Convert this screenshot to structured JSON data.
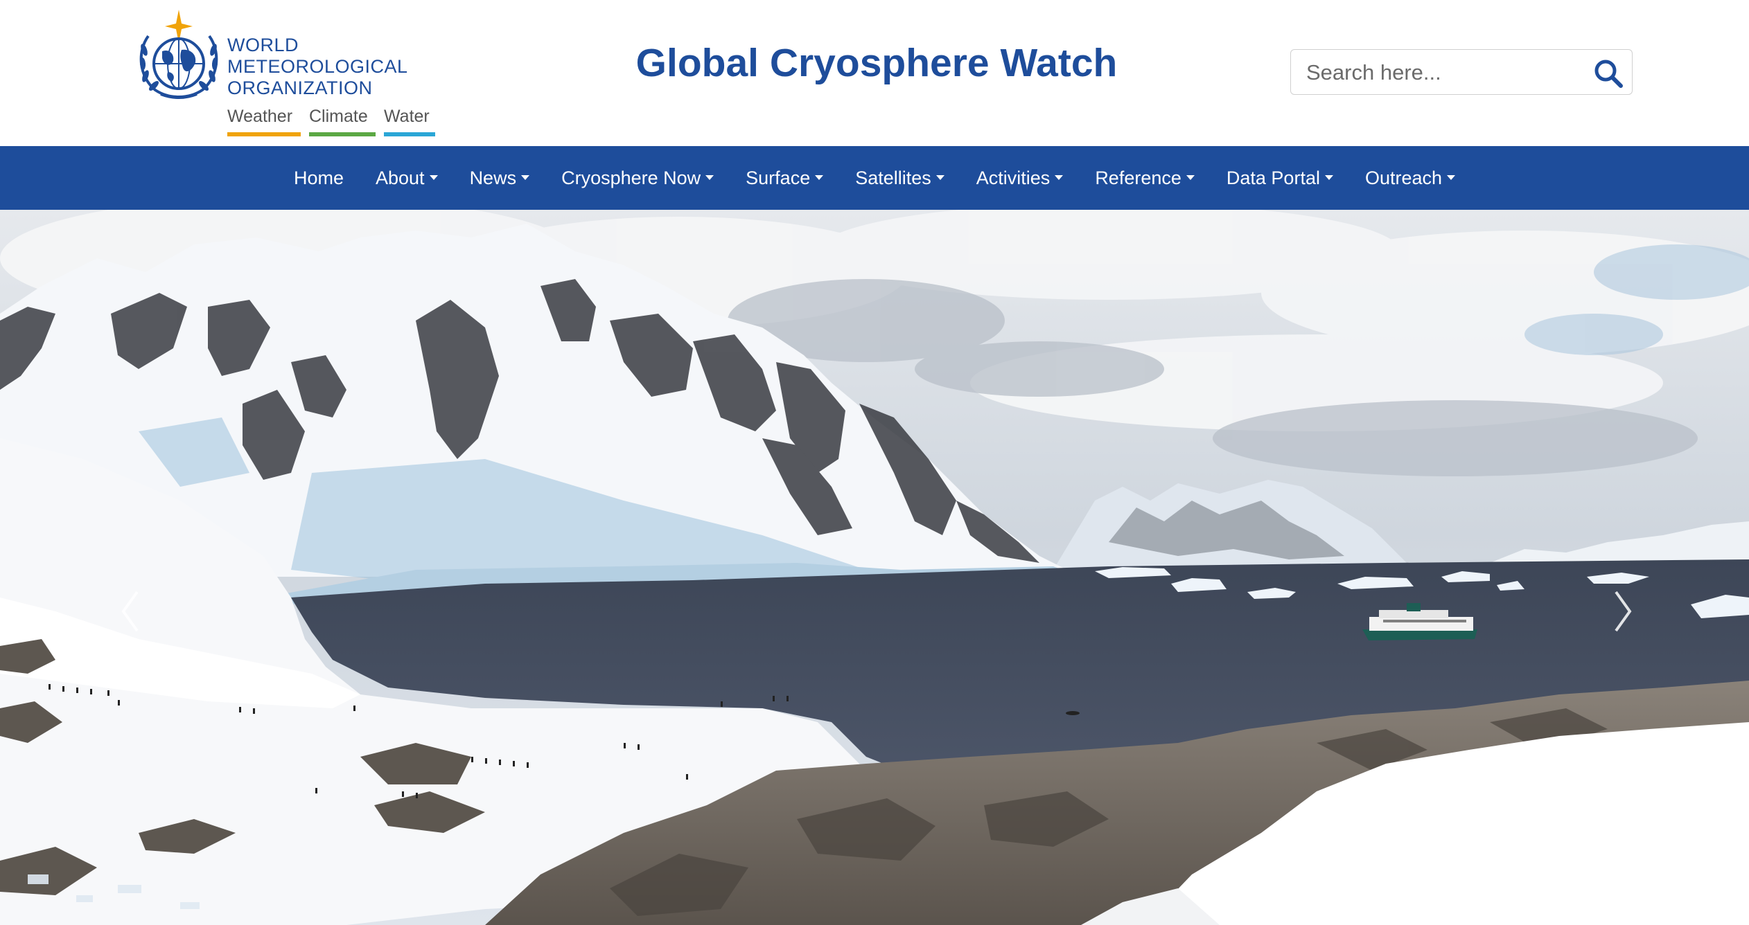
{
  "logo": {
    "org_lines": [
      "WORLD",
      "METEOROLOGICAL",
      "ORGANIZATION"
    ],
    "tags": [
      {
        "label": "Weather",
        "color": "#f0a30a"
      },
      {
        "label": "Climate",
        "color": "#5ba843"
      },
      {
        "label": "Water",
        "color": "#2aa6d6"
      }
    ]
  },
  "header": {
    "title": "Global Cryosphere Watch"
  },
  "search": {
    "placeholder": "Search here...",
    "value": ""
  },
  "nav": {
    "items": [
      {
        "label": "Home",
        "has_dropdown": false
      },
      {
        "label": "About",
        "has_dropdown": true
      },
      {
        "label": "News",
        "has_dropdown": true
      },
      {
        "label": "Cryosphere Now",
        "has_dropdown": true
      },
      {
        "label": "Surface",
        "has_dropdown": true
      },
      {
        "label": "Satellites",
        "has_dropdown": true
      },
      {
        "label": "Activities",
        "has_dropdown": true
      },
      {
        "label": "Reference",
        "has_dropdown": true
      },
      {
        "label": "Data Portal",
        "has_dropdown": true
      },
      {
        "label": "Outreach",
        "has_dropdown": true
      }
    ]
  },
  "hero": {
    "prev_icon": "chevron-left-icon",
    "next_icon": "chevron-right-icon"
  },
  "colors": {
    "brand_blue": "#1e4d9b",
    "white": "#ffffff"
  }
}
